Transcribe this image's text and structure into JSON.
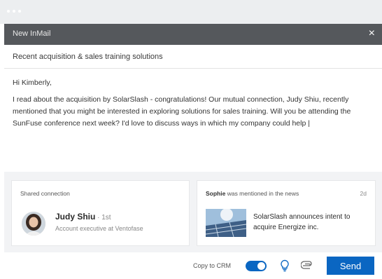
{
  "window": {
    "title": "New InMail",
    "close_glyph": "×"
  },
  "message": {
    "subject": "Recent acquisition & sales training solutions",
    "greeting": "Hi Kimberly,",
    "body": "I read about the acquisition by SolarSlash - congratulations! Our mutual connection, Judy Shiu, recently mentioned that you might be interested in exploring solutions for sales training. Will you be attending the SunFuse conference next week? I'd love to discuss ways in which my company could help |"
  },
  "shared_connection": {
    "label": "Shared connection",
    "name": "Judy Shiu",
    "separator": " · ",
    "degree": "1st",
    "title": "Account executive at Ventofase"
  },
  "news": {
    "person": "Sophie",
    "label_suffix": " was mentioned in the news",
    "age": "2d",
    "headline": "SolarSlash announces intent to acquire Energize inc."
  },
  "footer": {
    "crm_label": "Copy to CRM",
    "crm_enabled": true,
    "send_label": "Send"
  },
  "icons": {
    "close": "close-icon",
    "lightbulb": "lightbulb-icon",
    "attachment": "paperclip-icon"
  },
  "colors": {
    "accent": "#0a66c2",
    "title_bar": "#55585c",
    "card_area": "#f2f3f5"
  }
}
